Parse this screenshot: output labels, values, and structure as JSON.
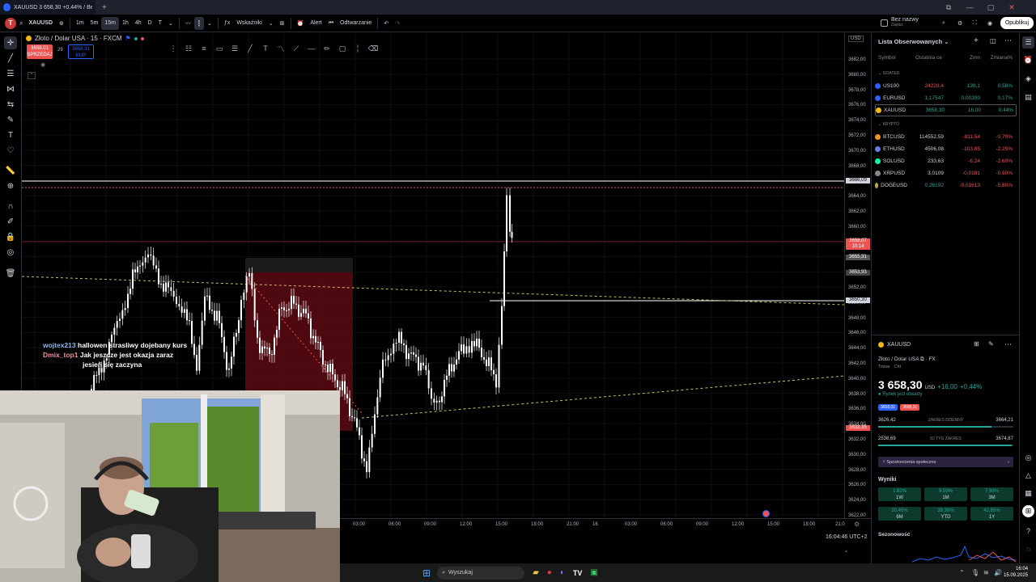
{
  "browser": {
    "tab_title": "XAUUSD 3 658,30 +0.44% / Bez...",
    "new_tab": "+"
  },
  "toolbar": {
    "avatar_initial": "T",
    "symbol": "XAUUSD",
    "intervals": [
      "1m",
      "5m",
      "15m",
      "1h",
      "4h",
      "D",
      "T"
    ],
    "selected_interval": "15m",
    "indicators_label": "Wskaźniki",
    "alert_label": "Alert",
    "replay_label": "Odtwarzanie",
    "layout_name": "Bez nazwy",
    "layout_sub": "Zapisz",
    "publish_label": "Opublikuj"
  },
  "chart": {
    "legend_title": "Złoto / Dolar USA · 15 · FXCM",
    "sell_price": "3658,01",
    "sell_label": "SPRZEDAJ",
    "spread": "29",
    "buy_price": "3658,31",
    "buy_label": "KUP",
    "currency": "USD",
    "price_labels": [
      "3682,00",
      "3680,00",
      "3678,00",
      "3676,00",
      "3674,00",
      "3672,00",
      "3670,00",
      "3668,00",
      "3664,00",
      "3662,00",
      "3660,00",
      "3658,00",
      "3656,00",
      "3654,00",
      "3652,00",
      "3650,00",
      "3648,00",
      "3646,00",
      "3644,00",
      "3642,00",
      "3640,00",
      "3638,00",
      "3636,00",
      "3634,00",
      "3632,00",
      "3630,00",
      "3628,00",
      "3626,00",
      "3624,00",
      "3622,00"
    ],
    "current_price_tag": "3658,07",
    "countdown_tag": "10:14",
    "tag_top": "3666,09",
    "tag_mid1": "3655,31",
    "tag_mid2": "3653,93",
    "tag_mid3": "3650,30",
    "tag_bottom": "3633,35",
    "time_labels": [
      "03:00",
      "06:00",
      "09:00",
      "12:00",
      "15:00",
      "18:00",
      "21:00",
      "16",
      "03:00",
      "06:00",
      "09:00",
      "12:00",
      "15:00",
      "18:00",
      "21:0"
    ],
    "clock": "16:04:46 UTC+2"
  },
  "stream_chat": [
    {
      "user": "wojtex213",
      "message": "hallowen strasliwy dojebany kurs"
    },
    {
      "user": "Dmix_top1",
      "message": "Jak jeszcze jest okazja zaraz"
    },
    {
      "user": "",
      "message": "jesień się zaczyna"
    }
  ],
  "watchlist": {
    "title": "Lista Obserwowanych",
    "headers": [
      "Symbol",
      "Ostatnia ce",
      "Zmn",
      "Zmiana%"
    ],
    "section1": "GOATED",
    "section2": "KRYPTO",
    "rows1": [
      {
        "sym": "US100",
        "price": "24228,4",
        "chg": "139,1",
        "pct": "0,58%",
        "icolor": "#2962ff",
        "pcolor": "#ef5350"
      },
      {
        "sym": "EURUSD",
        "price": "1,17547",
        "chg": "0,00200",
        "pct": "0,17%",
        "icolor": "#2962ff",
        "pcolor": "#26a69a"
      },
      {
        "sym": "XAUUSD",
        "price": "3658,30",
        "chg": "16,00",
        "pct": "0,44%",
        "icolor": "#f0b90b",
        "pcolor": "#26a69a"
      }
    ],
    "rows2": [
      {
        "sym": "BTCUSD",
        "price": "114552,59",
        "chg": "-811,54",
        "pct": "-0,70%",
        "icolor": "#f7931a",
        "pcolor": "#d1d4dc"
      },
      {
        "sym": "ETHUSD",
        "price": "4506,08",
        "chg": "-103,85",
        "pct": "-2,25%",
        "icolor": "#627eea",
        "pcolor": "#d1d4dc"
      },
      {
        "sym": "SOLUSD",
        "price": "233,63",
        "chg": "-6,24",
        "pct": "-2,60%",
        "icolor": "#00ffa3",
        "pcolor": "#d1d4dc"
      },
      {
        "sym": "XRPUSD",
        "price": "3,0109",
        "chg": "-0,0181",
        "pct": "-0,60%",
        "icolor": "#888888",
        "pcolor": "#d1d4dc"
      },
      {
        "sym": "DOGEUSD",
        "price": "0,26192",
        "chg": "-0,01613",
        "pct": "-5,80%",
        "icolor": "#c2a633",
        "pcolor": "#26a69a"
      }
    ]
  },
  "details": {
    "symbol": "XAUUSD",
    "name": "Złoto / Dolar USA",
    "exchange": "FX",
    "type": "Towar · Cfd",
    "price": "3 658,30",
    "currency": "USD",
    "change": "+16,00",
    "change_pct": "+0,44%",
    "market_status": "Rynek jest otwarty",
    "bid": "3658,01",
    "ask": "3658,31",
    "day_low": "3626,42",
    "day_range_label": "ZAKRES DZIENNY",
    "day_high": "3664,21",
    "year_low": "2536,69",
    "year_range_label": "52 TYG ZAKRES",
    "year_high": "3674,87",
    "day_range_position": 0.84,
    "year_range_position": 0.99,
    "community_label": "Spostrzeżenia społeczne",
    "results_title": "Wyniki",
    "performance": [
      {
        "value": "1,82%",
        "period": "1W"
      },
      {
        "value": "9,59%",
        "period": "1M"
      },
      {
        "value": "7,99%",
        "period": "3M"
      },
      {
        "value": "20,45%",
        "period": "6M"
      },
      {
        "value": "39,30%",
        "period": "YTD"
      },
      {
        "value": "42,85%",
        "period": "1Y"
      }
    ],
    "seasonality_title": "Sezonowość"
  },
  "taskbar": {
    "search_placeholder": "Wyszukaj",
    "time": "16:04",
    "date": "15.09.2025"
  },
  "colors": {
    "up": "#26a69a",
    "down": "#ef5350",
    "accent": "#2962ff",
    "zone": "#5c0b13"
  }
}
